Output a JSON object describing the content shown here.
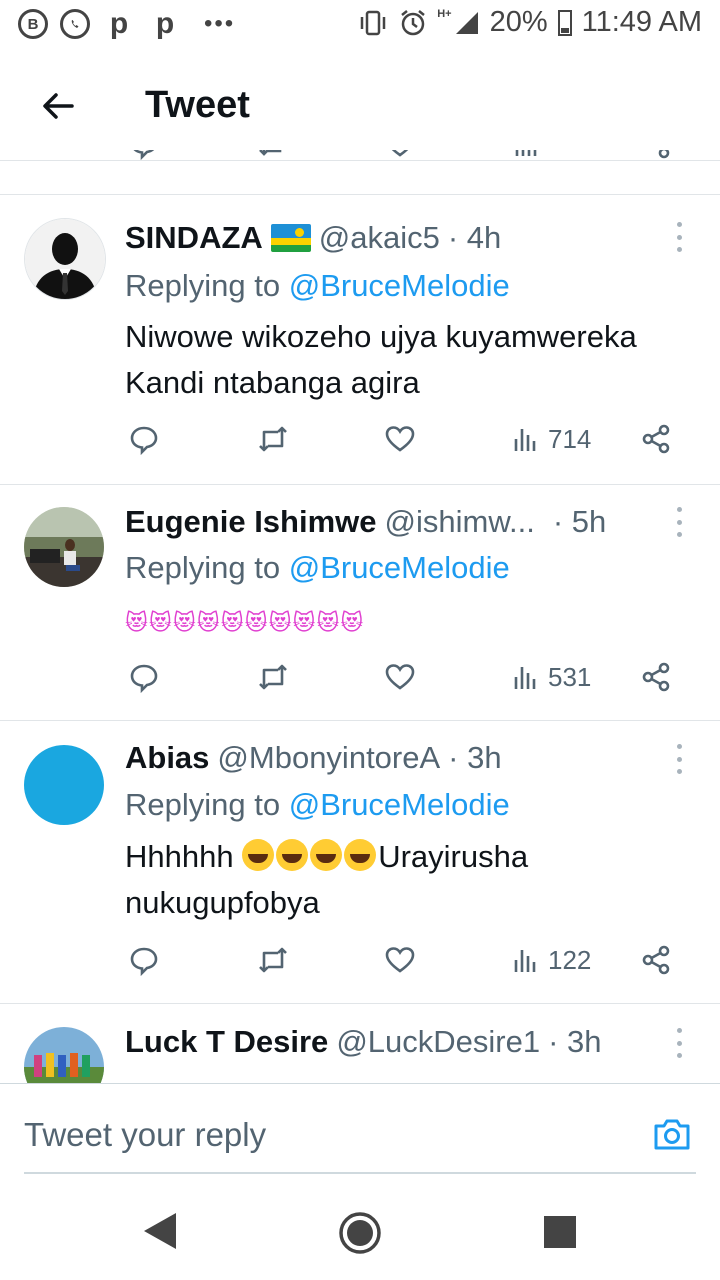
{
  "status_bar": {
    "battery": "20%",
    "time": "11:49 AM",
    "network": "H+",
    "dots": "•••"
  },
  "header": {
    "title": "Tweet"
  },
  "tweets": [
    {
      "name": "SINDAZA",
      "handle": "@akaic5",
      "time": "· 4h",
      "replying_prefix": "Replying to ",
      "replying_to": "@BruceMelodie",
      "text": "Niwowe wikozeho ujya kuyamwereka Kandi ntabanga agira",
      "views": "714"
    },
    {
      "name": "Eugenie Ishimwe",
      "handle": "@ishimw...",
      "time": "· 5h",
      "replying_prefix": "Replying to ",
      "replying_to": "@BruceMelodie",
      "text": "😻😻😻😻😻😻😻😻😻😻",
      "views": "531"
    },
    {
      "name": "Abias",
      "handle": "@MbonyintoreA",
      "time": "· 3h",
      "replying_prefix": "Replying to ",
      "replying_to": "@BruceMelodie",
      "text_start": "Hhhhhh",
      "text_end": "Urayirusha nukugupfobya",
      "views": "122"
    },
    {
      "name": "Luck T Desire",
      "handle": "@LuckDesire1",
      "time": "· 3h"
    }
  ],
  "reply_bar": {
    "placeholder": "Tweet your reply"
  },
  "colors": {
    "accent": "#1d9bf0",
    "text": "#0f1419",
    "secondary": "#536471"
  },
  "icons": [
    "back-arrow-icon",
    "reply-icon",
    "retweet-icon",
    "like-icon",
    "views-icon",
    "share-icon",
    "more-icon",
    "camera-icon",
    "nav-back-icon",
    "nav-home-icon",
    "nav-recents-icon"
  ]
}
